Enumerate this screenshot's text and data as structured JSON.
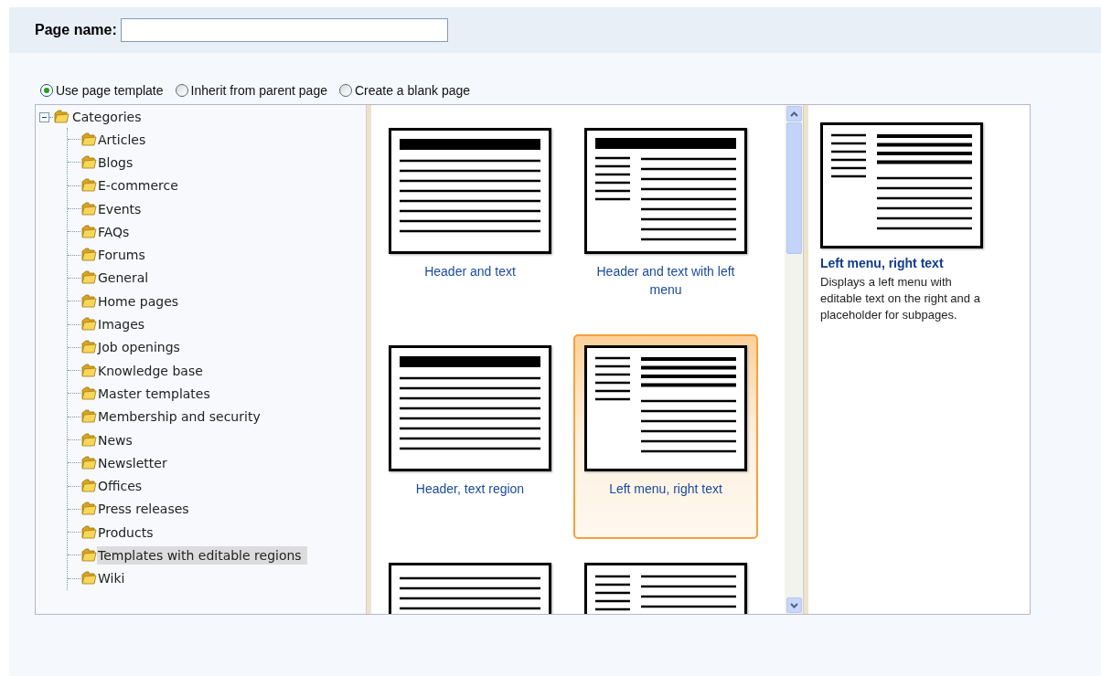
{
  "page_name": {
    "label": "Page name:"
  },
  "source_options": [
    {
      "label": "Use page template",
      "selected": true
    },
    {
      "label": "Inherit from parent page",
      "selected": false
    },
    {
      "label": "Create a blank page",
      "selected": false
    }
  ],
  "category_tree": {
    "label": "Categories",
    "expanded": true,
    "selected": false,
    "children": [
      {
        "label": "Articles",
        "selected": false
      },
      {
        "label": "Blogs",
        "selected": false
      },
      {
        "label": "E-commerce",
        "selected": false
      },
      {
        "label": "Events",
        "selected": false
      },
      {
        "label": "FAQs",
        "selected": false
      },
      {
        "label": "Forums",
        "selected": false
      },
      {
        "label": "General",
        "selected": false
      },
      {
        "label": "Home pages",
        "selected": false
      },
      {
        "label": "Images",
        "selected": false
      },
      {
        "label": "Job openings",
        "selected": false
      },
      {
        "label": "Knowledge base",
        "selected": false
      },
      {
        "label": "Master templates",
        "selected": false
      },
      {
        "label": "Membership and security",
        "selected": false
      },
      {
        "label": "News",
        "selected": false
      },
      {
        "label": "Newsletter",
        "selected": false
      },
      {
        "label": "Offices",
        "selected": false
      },
      {
        "label": "Press releases",
        "selected": false
      },
      {
        "label": "Products",
        "selected": false
      },
      {
        "label": "Templates with editable regions",
        "selected": true
      },
      {
        "label": "Wiki",
        "selected": false
      }
    ]
  },
  "templates": [
    {
      "label": "Header and text",
      "kind": "header_text",
      "selected": false
    },
    {
      "label": "Header and text with left menu",
      "kind": "header_left_menu",
      "selected": false
    },
    {
      "label": "Header, text region",
      "kind": "header_text",
      "selected": false
    },
    {
      "label": "Left menu, right text",
      "kind": "left_menu_text",
      "selected": true
    },
    {
      "kind": "text_lines",
      "selected": false
    },
    {
      "kind": "left_menu_lines",
      "selected": false
    }
  ],
  "preview": {
    "kind": "left_menu_text",
    "title": "Left menu, right text",
    "description": "Displays a left menu with editable text on the right and a placeholder for subpages."
  }
}
